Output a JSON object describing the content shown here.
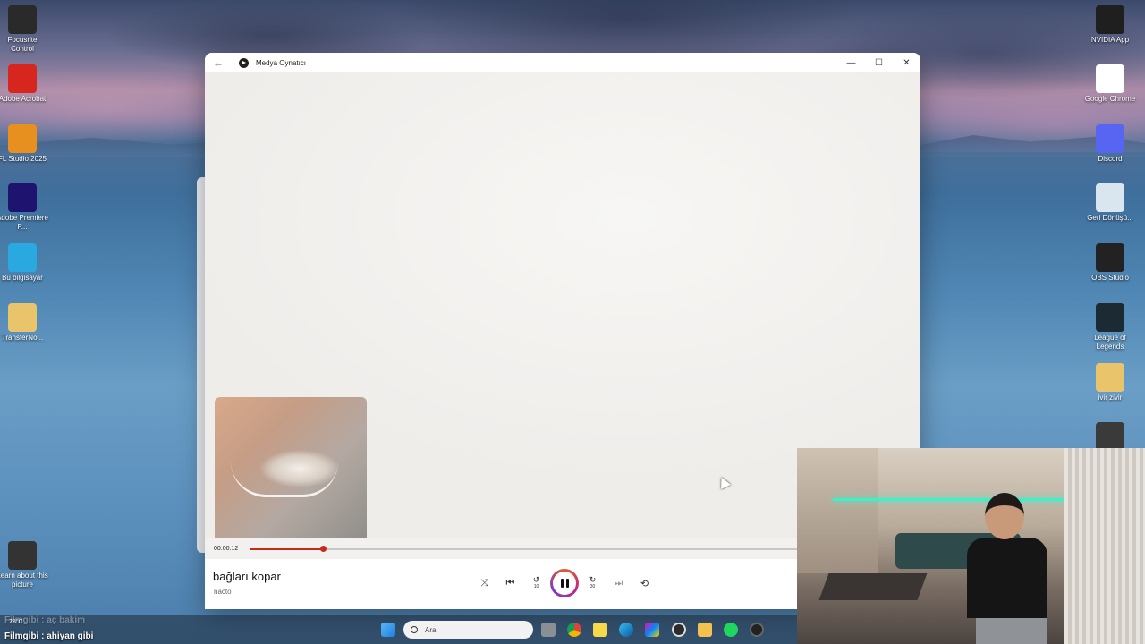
{
  "desktop": {
    "left_icons": [
      {
        "label": "Focusrite Control",
        "icon": "focusrite-icon",
        "color": "#2a2a2a"
      },
      {
        "label": "Adobe Acrobat",
        "icon": "acrobat-icon",
        "color": "#d7261e"
      },
      {
        "label": "FL Studio 2025",
        "icon": "fl-studio-icon",
        "color": "#e8901f"
      },
      {
        "label": "Adobe Premiere P...",
        "icon": "premiere-icon",
        "color": "#1e1470"
      },
      {
        "label": "Bu bilgisayar",
        "icon": "computer-icon",
        "color": "#2aa9e0"
      },
      {
        "label": "TransferNo...",
        "icon": "folder-icon",
        "color": "#e9c46a"
      },
      {
        "label": "Learn about this picture",
        "icon": "learn-icon",
        "color": "#333333"
      }
    ],
    "right_icons": [
      {
        "label": "NVIDIA App",
        "icon": "nvidia-icon",
        "color": "#1f1f1f"
      },
      {
        "label": "Google Chrome",
        "icon": "chrome-icon",
        "color": "#ffffff"
      },
      {
        "label": "Discord",
        "icon": "discord-icon",
        "color": "#5865f2"
      },
      {
        "label": "Geri Dönüşü...",
        "icon": "recycle-bin-icon",
        "color": "#d9e6ef"
      },
      {
        "label": "OBS Studio",
        "icon": "obs-icon",
        "color": "#222222"
      },
      {
        "label": "League of Legends",
        "icon": "league-icon",
        "color": "#1b2a33"
      },
      {
        "label": "ivir zivir",
        "icon": "folder-icon",
        "color": "#e9c46a"
      },
      {
        "label": "",
        "icon": "app-icon",
        "color": "#3a3a3a"
      }
    ]
  },
  "player": {
    "window_title": "Medya Oynatıcı",
    "back_glyph": "←",
    "minimize_glyph": "—",
    "maximize_glyph": "☐",
    "close_glyph": "✕",
    "elapsed": "00:00:12",
    "progress_fraction": 0.13,
    "accent_color": "#c42b1c",
    "song_title": "bağları kopar",
    "artist": "nacto",
    "controls": {
      "shuffle": "⤨",
      "previous": "⏮",
      "rewind": "↺",
      "rewind_label": "10",
      "forward": "↻",
      "forward_label": "30",
      "next": "⏭",
      "repeat": "⟲"
    }
  },
  "taskbar": {
    "search_placeholder": "Ara",
    "weather_temp": "23°C"
  },
  "overlay": {
    "line1": "Filmgibi : aç bakim",
    "line2": "Filmgibi : ahiyan gibi"
  }
}
